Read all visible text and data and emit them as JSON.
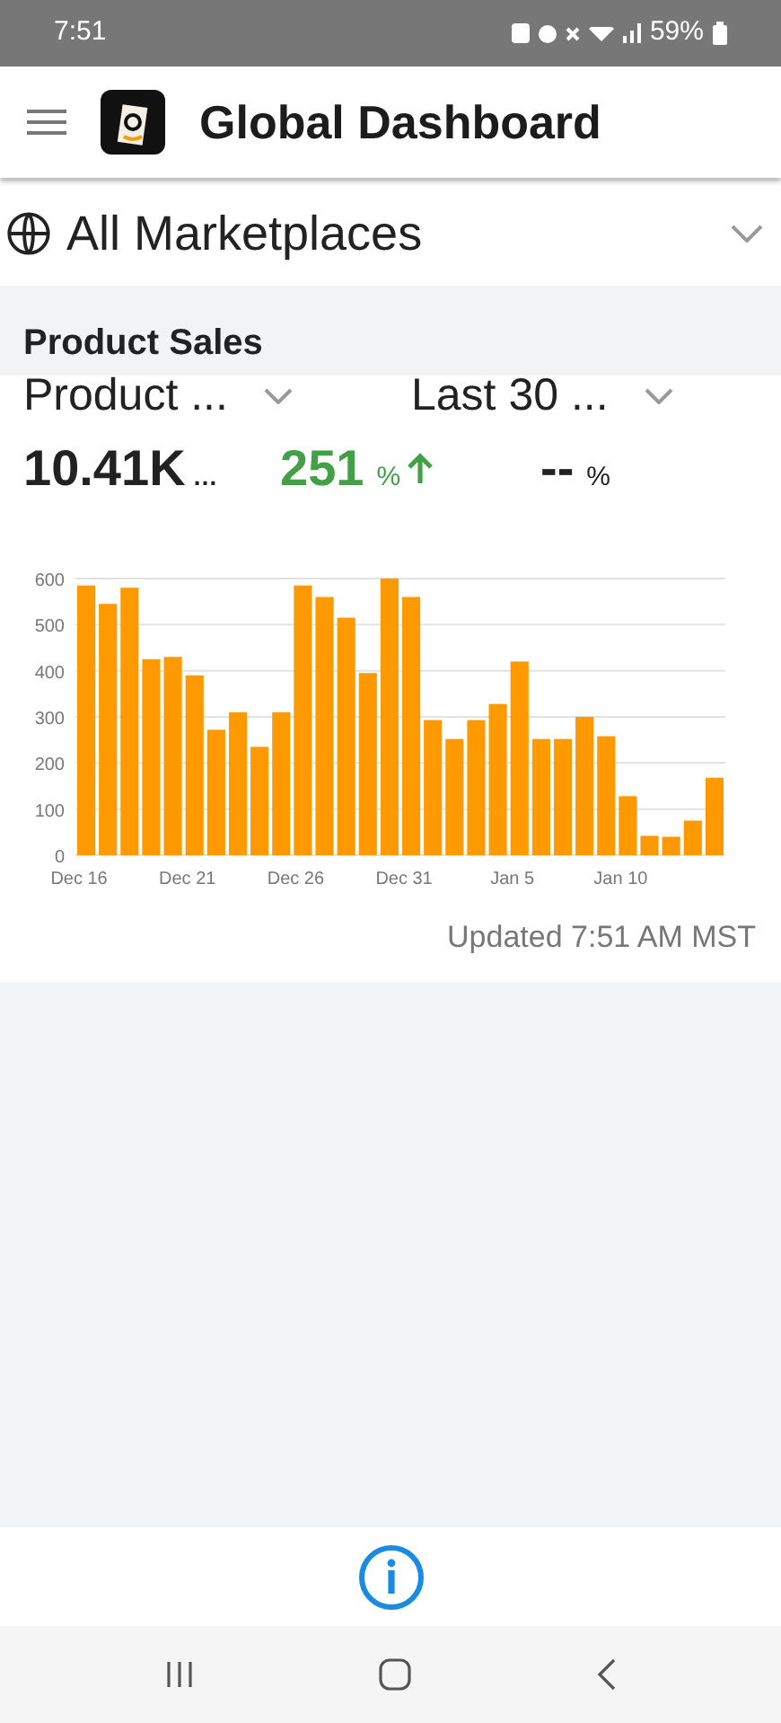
{
  "status_bar": {
    "time": "7:51",
    "battery": "59%"
  },
  "app_bar": {
    "title": "Global Dashboard"
  },
  "marketplace": {
    "label": "All Marketplaces"
  },
  "section": {
    "title": "Product Sales"
  },
  "selectors": [
    {
      "label": "Product ..."
    },
    {
      "label": "Last 30 ..."
    }
  ],
  "metrics": [
    {
      "kind": "value",
      "value": "10.41K",
      "suffix": "…"
    },
    {
      "kind": "change",
      "value": "251",
      "suffix": "%",
      "color": "#43a047"
    },
    {
      "kind": "change_empty",
      "value": "--",
      "suffix": "%",
      "color": "#222222"
    }
  ],
  "chart_data": {
    "type": "bar",
    "grid": true,
    "categories": [
      "Dec 16",
      null,
      null,
      null,
      null,
      "Dec 21",
      null,
      null,
      null,
      null,
      "Dec 26",
      null,
      null,
      null,
      null,
      "Dec 31",
      null,
      null,
      null,
      null,
      "Jan 5",
      null,
      null,
      null,
      null,
      "Jan 10",
      null,
      null,
      null,
      null
    ],
    "series": [
      {
        "color": "#ff9900",
        "values": [
          585,
          545,
          580,
          425,
          430,
          390,
          272,
          310,
          235,
          310,
          585,
          560,
          515,
          395,
          600,
          560,
          293,
          252,
          293,
          328,
          420,
          252,
          252,
          300,
          258,
          128,
          42,
          40,
          75,
          168
        ]
      }
    ],
    "ylim": [
      0,
      600
    ],
    "yticks": [
      0,
      100,
      200,
      300,
      400,
      500,
      600
    ]
  },
  "updated": "Updated 7:51 AM MST"
}
